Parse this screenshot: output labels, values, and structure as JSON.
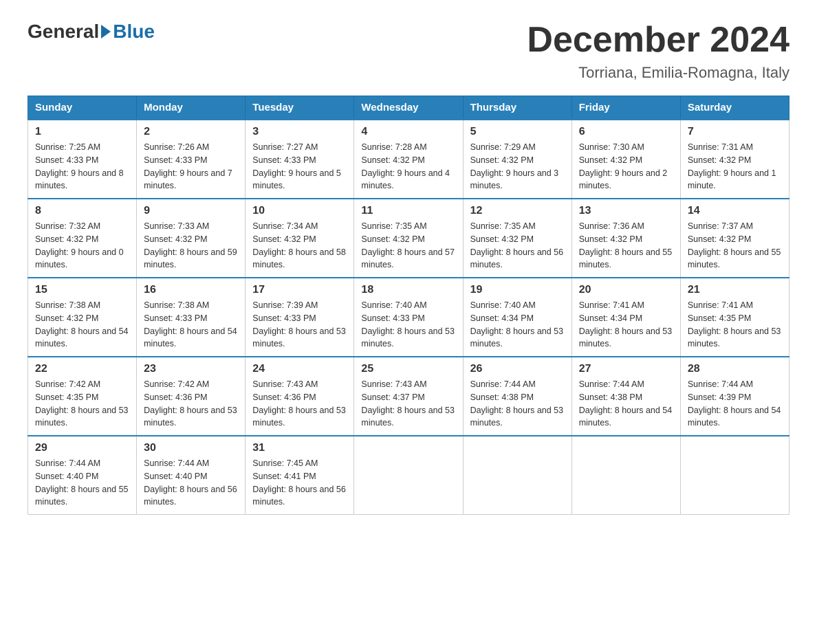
{
  "header": {
    "logo_general": "General",
    "logo_blue": "Blue",
    "month_title": "December 2024",
    "location": "Torriana, Emilia-Romagna, Italy"
  },
  "days_of_week": [
    "Sunday",
    "Monday",
    "Tuesday",
    "Wednesday",
    "Thursday",
    "Friday",
    "Saturday"
  ],
  "weeks": [
    [
      {
        "day": "1",
        "sunrise": "7:25 AM",
        "sunset": "4:33 PM",
        "daylight": "9 hours and 8 minutes."
      },
      {
        "day": "2",
        "sunrise": "7:26 AM",
        "sunset": "4:33 PM",
        "daylight": "9 hours and 7 minutes."
      },
      {
        "day": "3",
        "sunrise": "7:27 AM",
        "sunset": "4:33 PM",
        "daylight": "9 hours and 5 minutes."
      },
      {
        "day": "4",
        "sunrise": "7:28 AM",
        "sunset": "4:32 PM",
        "daylight": "9 hours and 4 minutes."
      },
      {
        "day": "5",
        "sunrise": "7:29 AM",
        "sunset": "4:32 PM",
        "daylight": "9 hours and 3 minutes."
      },
      {
        "day": "6",
        "sunrise": "7:30 AM",
        "sunset": "4:32 PM",
        "daylight": "9 hours and 2 minutes."
      },
      {
        "day": "7",
        "sunrise": "7:31 AM",
        "sunset": "4:32 PM",
        "daylight": "9 hours and 1 minute."
      }
    ],
    [
      {
        "day": "8",
        "sunrise": "7:32 AM",
        "sunset": "4:32 PM",
        "daylight": "9 hours and 0 minutes."
      },
      {
        "day": "9",
        "sunrise": "7:33 AM",
        "sunset": "4:32 PM",
        "daylight": "8 hours and 59 minutes."
      },
      {
        "day": "10",
        "sunrise": "7:34 AM",
        "sunset": "4:32 PM",
        "daylight": "8 hours and 58 minutes."
      },
      {
        "day": "11",
        "sunrise": "7:35 AM",
        "sunset": "4:32 PM",
        "daylight": "8 hours and 57 minutes."
      },
      {
        "day": "12",
        "sunrise": "7:35 AM",
        "sunset": "4:32 PM",
        "daylight": "8 hours and 56 minutes."
      },
      {
        "day": "13",
        "sunrise": "7:36 AM",
        "sunset": "4:32 PM",
        "daylight": "8 hours and 55 minutes."
      },
      {
        "day": "14",
        "sunrise": "7:37 AM",
        "sunset": "4:32 PM",
        "daylight": "8 hours and 55 minutes."
      }
    ],
    [
      {
        "day": "15",
        "sunrise": "7:38 AM",
        "sunset": "4:32 PM",
        "daylight": "8 hours and 54 minutes."
      },
      {
        "day": "16",
        "sunrise": "7:38 AM",
        "sunset": "4:33 PM",
        "daylight": "8 hours and 54 minutes."
      },
      {
        "day": "17",
        "sunrise": "7:39 AM",
        "sunset": "4:33 PM",
        "daylight": "8 hours and 53 minutes."
      },
      {
        "day": "18",
        "sunrise": "7:40 AM",
        "sunset": "4:33 PM",
        "daylight": "8 hours and 53 minutes."
      },
      {
        "day": "19",
        "sunrise": "7:40 AM",
        "sunset": "4:34 PM",
        "daylight": "8 hours and 53 minutes."
      },
      {
        "day": "20",
        "sunrise": "7:41 AM",
        "sunset": "4:34 PM",
        "daylight": "8 hours and 53 minutes."
      },
      {
        "day": "21",
        "sunrise": "7:41 AM",
        "sunset": "4:35 PM",
        "daylight": "8 hours and 53 minutes."
      }
    ],
    [
      {
        "day": "22",
        "sunrise": "7:42 AM",
        "sunset": "4:35 PM",
        "daylight": "8 hours and 53 minutes."
      },
      {
        "day": "23",
        "sunrise": "7:42 AM",
        "sunset": "4:36 PM",
        "daylight": "8 hours and 53 minutes."
      },
      {
        "day": "24",
        "sunrise": "7:43 AM",
        "sunset": "4:36 PM",
        "daylight": "8 hours and 53 minutes."
      },
      {
        "day": "25",
        "sunrise": "7:43 AM",
        "sunset": "4:37 PM",
        "daylight": "8 hours and 53 minutes."
      },
      {
        "day": "26",
        "sunrise": "7:44 AM",
        "sunset": "4:38 PM",
        "daylight": "8 hours and 53 minutes."
      },
      {
        "day": "27",
        "sunrise": "7:44 AM",
        "sunset": "4:38 PM",
        "daylight": "8 hours and 54 minutes."
      },
      {
        "day": "28",
        "sunrise": "7:44 AM",
        "sunset": "4:39 PM",
        "daylight": "8 hours and 54 minutes."
      }
    ],
    [
      {
        "day": "29",
        "sunrise": "7:44 AM",
        "sunset": "4:40 PM",
        "daylight": "8 hours and 55 minutes."
      },
      {
        "day": "30",
        "sunrise": "7:44 AM",
        "sunset": "4:40 PM",
        "daylight": "8 hours and 56 minutes."
      },
      {
        "day": "31",
        "sunrise": "7:45 AM",
        "sunset": "4:41 PM",
        "daylight": "8 hours and 56 minutes."
      },
      null,
      null,
      null,
      null
    ]
  ]
}
